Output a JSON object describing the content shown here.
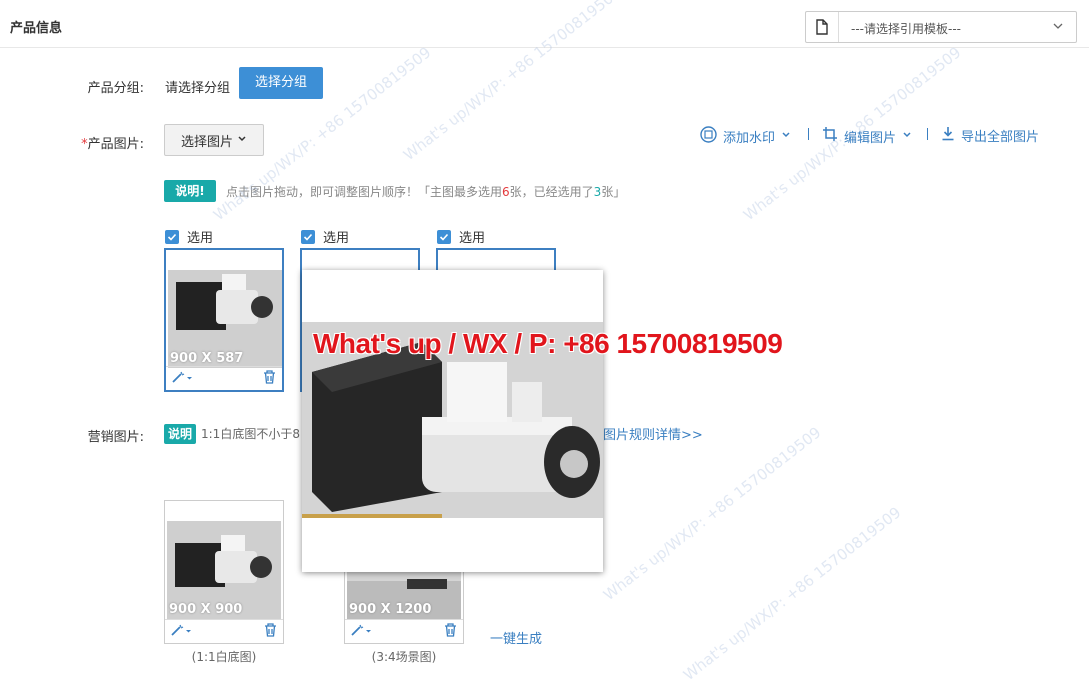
{
  "header": {
    "title": "产品信息",
    "template_placeholder": "---请选择引用模板---"
  },
  "group": {
    "label": "产品分组:",
    "placeholder": "请选择分组",
    "button": "选择分组"
  },
  "product_images": {
    "required_mark": "*",
    "label": "产品图片:",
    "select_button": "选择图片",
    "tools": {
      "watermark": "添加水印",
      "edit": "编辑图片",
      "export": "导出全部图片"
    },
    "tip_badge": "说明!",
    "tip_text_a": "点击图片拖动，即可调整图片顺序！「主图最多选用",
    "tip_max": "6",
    "tip_text_b": "张，已经选用了",
    "tip_used": "3",
    "tip_text_c": "张」",
    "items": [
      {
        "check_label": "选用",
        "dimension": "900 X 587"
      },
      {
        "check_label": "选用",
        "dimension": ""
      },
      {
        "check_label": "选用",
        "dimension": ""
      }
    ]
  },
  "marketing_images": {
    "label": "营销图片:",
    "badge": "说明",
    "tip_text": "1:1白底图不小于8",
    "rule_link": "图片规则详情>>",
    "items": [
      {
        "dimension": "900 X 900",
        "caption": "(1:1白底图)"
      },
      {
        "dimension": "900 X 1200",
        "caption": "(3:4场景图)"
      }
    ],
    "generate_link": "一键生成"
  },
  "overlay": {
    "watermark_text": "What's up / WX / P: +86 15700819509",
    "diag_watermark": "What's up/WX/P: +86 15700819509"
  },
  "colors": {
    "accent": "#3d8fd6",
    "badge": "#19a9a9",
    "watermark": "#e1151c"
  }
}
